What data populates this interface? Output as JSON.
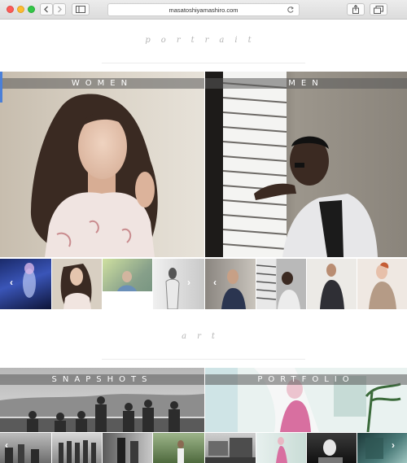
{
  "browser": {
    "url": "masatoshiyamashiro.com",
    "icons": [
      "back-icon",
      "forward-icon",
      "sidebar-icon",
      "reload-icon",
      "share-icon",
      "tabs-icon"
    ]
  },
  "portrait": {
    "title": "portrait",
    "women_label": "WOMEN",
    "men_label": "MEN"
  },
  "art": {
    "title": "art",
    "snapshots_label": "SNAPSHOTS",
    "portfolio_label": "PORTFOLIO"
  },
  "colors": {
    "accent": "#4a7fd8",
    "band": "#5a5a5a",
    "title": "#b5b5b5"
  }
}
